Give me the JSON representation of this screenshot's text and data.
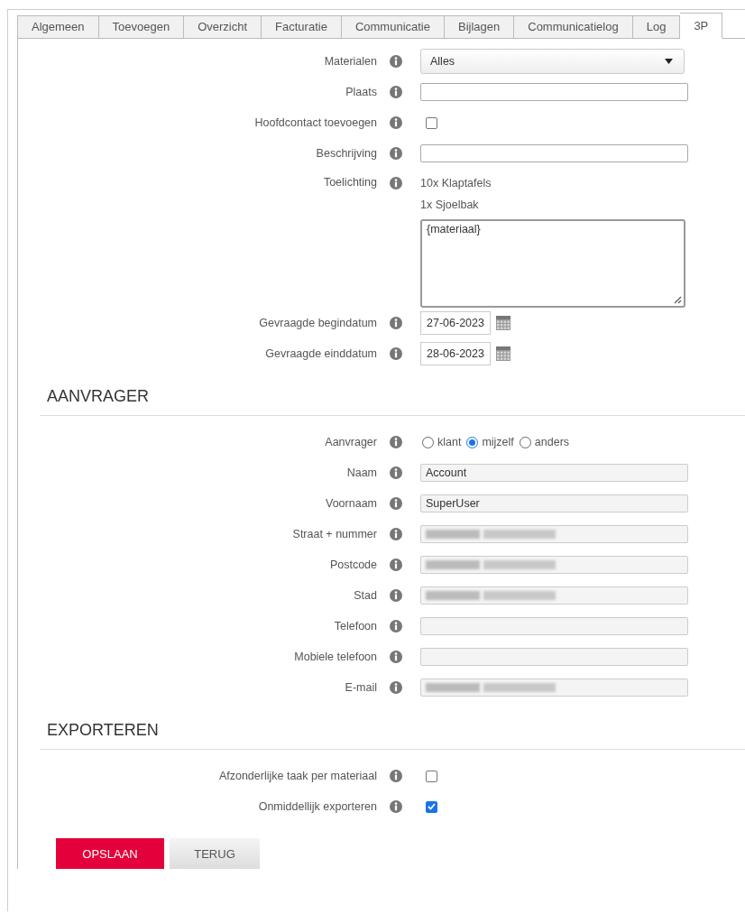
{
  "tabs": [
    {
      "label": "Algemeen",
      "selected": false
    },
    {
      "label": "Toevoegen",
      "selected": false
    },
    {
      "label": "Overzicht",
      "selected": false
    },
    {
      "label": "Facturatie",
      "selected": false
    },
    {
      "label": "Communicatie",
      "selected": false
    },
    {
      "label": "Bijlagen",
      "selected": false
    },
    {
      "label": "Communicatielog",
      "selected": false
    },
    {
      "label": "Log",
      "selected": false
    },
    {
      "label": "3P",
      "selected": true
    }
  ],
  "details": [
    {
      "kind": "select",
      "label": "Materialen",
      "value": "Alles"
    },
    {
      "kind": "text",
      "label": "Plaats",
      "readonly": false
    },
    {
      "kind": "checkbox",
      "label": "Hoofdcontact toevoegen",
      "checked": false
    },
    {
      "kind": "text",
      "label": "Beschrijving",
      "readonly": false
    },
    {
      "kind": "notes",
      "label": "Toelichting",
      "lines": [
        "10x Klaptafels",
        "1x Sjoelbak"
      ],
      "value": "{materiaal}"
    },
    {
      "kind": "date",
      "label": "Gevraagde begindatum",
      "value": "27-06-2023"
    },
    {
      "kind": "date",
      "label": "Gevraagde einddatum",
      "value": "28-06-2023"
    }
  ],
  "aanvrager": {
    "title": "AANVRAGER",
    "fields": [
      {
        "kind": "radio",
        "label": "Aanvrager",
        "options": [
          {
            "label": "klant",
            "selected": false
          },
          {
            "label": "mijzelf",
            "selected": true
          },
          {
            "label": "anders",
            "selected": false
          }
        ]
      },
      {
        "kind": "text",
        "label": "Naam",
        "value": "Account",
        "readonly": true
      },
      {
        "kind": "text",
        "label": "Voornaam",
        "value": "SuperUser",
        "readonly": true
      },
      {
        "kind": "text",
        "label": "Straat + nummer",
        "readonly": true,
        "redacted": true
      },
      {
        "kind": "text",
        "label": "Postcode",
        "readonly": true,
        "redacted": true
      },
      {
        "kind": "text",
        "label": "Stad",
        "readonly": true,
        "redacted": true
      },
      {
        "kind": "text",
        "label": "Telefoon",
        "readonly": true
      },
      {
        "kind": "text",
        "label": "Mobiele telefoon",
        "readonly": true
      },
      {
        "kind": "text",
        "label": "E-mail",
        "readonly": true,
        "redacted": true
      }
    ]
  },
  "exporteren": {
    "title": "EXPORTEREN",
    "fields": [
      {
        "kind": "checkbox",
        "label": "Afzonderlijke taak per materiaal",
        "checked": false
      },
      {
        "kind": "checkbox",
        "label": "Onmiddellijk exporteren",
        "checked": true
      }
    ]
  },
  "buttons": [
    {
      "label": "OPSLAAN",
      "kind": "primary"
    },
    {
      "label": "TERUG",
      "kind": "secondary"
    }
  ]
}
